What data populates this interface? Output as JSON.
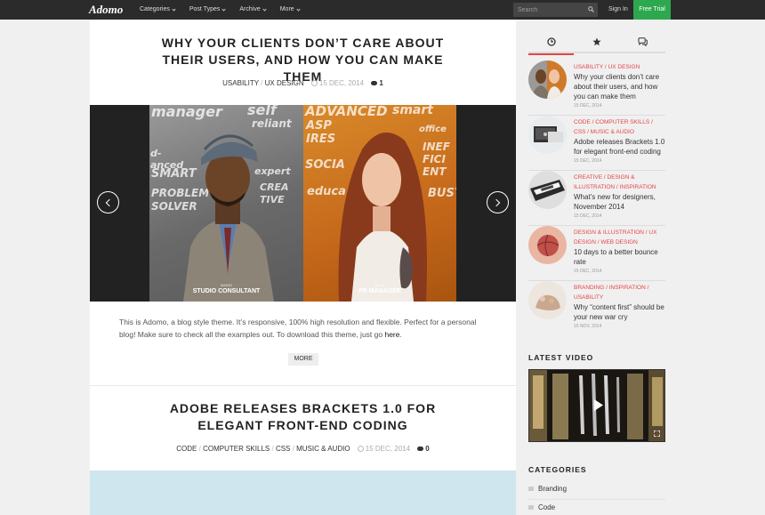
{
  "header": {
    "logo": "Adomo",
    "nav": [
      {
        "label": "Categories"
      },
      {
        "label": "Post Types"
      },
      {
        "label": "Archive"
      },
      {
        "label": "More"
      }
    ],
    "search_placeholder": "Search",
    "signin": "Sign In",
    "free_trial": "Free Trial",
    "colors": {
      "bar": "#2b2b2b",
      "trial": "#2ea84e"
    }
  },
  "posts": [
    {
      "title": "WHY YOUR CLIENTS DON’T CARE ABOUT THEIR USERS, AND HOW YOU CAN MAKE THEM",
      "categories": [
        "USABILITY",
        "UX DESIGN"
      ],
      "date": "15 DEC, 2014",
      "comments": "1",
      "slides": {
        "left_caption_small": "MARIO",
        "left_caption": "STUDIO CONSULTANT",
        "right_caption_small": "ELLIE",
        "right_caption": "PR MANAGER"
      },
      "excerpt": "This is Adomo, a blog style theme. It’s responsive, 100% high resolution and flexible. Perfect for a personal blog! Make sure to check all the examples out. To download this theme, just go ",
      "excerpt_link": "here",
      "excerpt_end": ".",
      "more": "MORE"
    },
    {
      "title": "ADOBE RELEASES BRACKETS 1.0 FOR ELEGANT FRONT-END CODING",
      "categories": [
        "CODE",
        "COMPUTER SKILLS",
        "CSS",
        "MUSIC & AUDIO"
      ],
      "date": "15 DEC, 2014",
      "comments": "0"
    }
  ],
  "sidebar": {
    "tabs": [
      {
        "icon": "clock-icon",
        "active": true
      },
      {
        "icon": "star-icon",
        "active": false
      },
      {
        "icon": "comments-icon",
        "active": false
      }
    ],
    "recent": [
      {
        "cats": "USABILITY / UX DESIGN",
        "title": "Why your clients don’t care about their users, and how you can make them",
        "date": "15 DEC, 2014"
      },
      {
        "cats": "CODE / COMPUTER SKILLS / CSS / MUSIC & AUDIO",
        "title": "Adobe releases Brackets 1.0 for elegant front-end coding",
        "date": "15 DEC, 2014"
      },
      {
        "cats": "CREATIVE / DESIGN & ILLUSTRATION / INSPIRATION",
        "title": "What’s new for designers, November 2014",
        "date": "15 DEC, 2014"
      },
      {
        "cats": "DESIGN & ILLUSTRATION / UX DESIGN / WEB DESIGN",
        "title": "10 days to a better bounce rate",
        "date": "15 DEC, 2014"
      },
      {
        "cats": "BRANDING / INSPIRATION / USABILITY",
        "title": "Why “content first” should be your new war cry",
        "date": "15 NOV, 2014"
      }
    ],
    "latest_video_heading": "LATEST VIDEO",
    "categories_heading": "CATEGORIES",
    "categories": [
      "Branding",
      "Code"
    ],
    "accent": "#e54545"
  }
}
